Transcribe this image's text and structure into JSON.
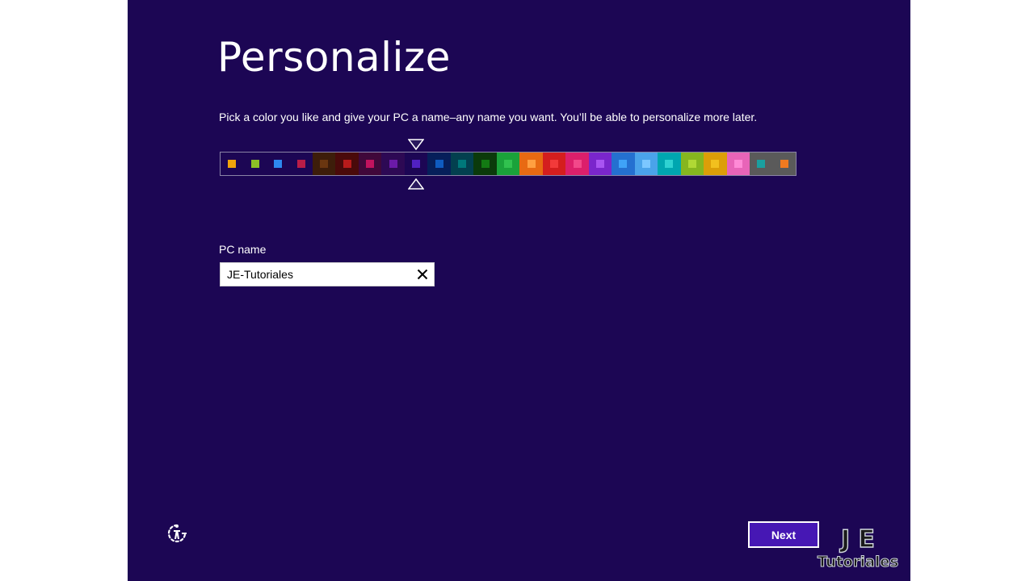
{
  "page": {
    "title": "Personalize",
    "subtitle": "Pick a color you like and give your PC a name–any name you want. You’ll be able to personalize more later.",
    "background": "#1c0654"
  },
  "color_picker": {
    "selected_index": 8,
    "cells": [
      {
        "bg": "#1c0654",
        "swatch": "#f0a30a"
      },
      {
        "bg": "#1c0654",
        "swatch": "#8cbf26"
      },
      {
        "bg": "#1c0654",
        "swatch": "#2d89ef"
      },
      {
        "bg": "#1c0654",
        "swatch": "#b91d47"
      },
      {
        "bg": "#3d1d0a",
        "swatch": "#6a3610"
      },
      {
        "bg": "#4a0a0a",
        "swatch": "#b81b1b"
      },
      {
        "bg": "#40083a",
        "swatch": "#c1135e"
      },
      {
        "bg": "#2d0954",
        "swatch": "#6b1aa8"
      },
      {
        "bg": "#1c0654",
        "swatch": "#5121c2"
      },
      {
        "bg": "#061f5a",
        "swatch": "#0f5cc0"
      },
      {
        "bg": "#03404f",
        "swatch": "#00787a"
      },
      {
        "bg": "#0b3a0b",
        "swatch": "#137a13"
      },
      {
        "bg": "#1aa23a",
        "swatch": "#31c24f"
      },
      {
        "bg": "#e86a12",
        "swatch": "#ffa041"
      },
      {
        "bg": "#d41e1e",
        "swatch": "#f23a3a"
      },
      {
        "bg": "#dc1f6b",
        "swatch": "#f2488a"
      },
      {
        "bg": "#7a26cc",
        "swatch": "#a954f2"
      },
      {
        "bg": "#2470d0",
        "swatch": "#3fa3f7"
      },
      {
        "bg": "#4aa3ea",
        "swatch": "#7cc7ff"
      },
      {
        "bg": "#00a6b0",
        "swatch": "#2fd2d2"
      },
      {
        "bg": "#86b61f",
        "swatch": "#b0d835"
      },
      {
        "bg": "#dc9e08",
        "swatch": "#f2c01e"
      },
      {
        "bg": "#e864b8",
        "swatch": "#ff8ad6"
      },
      {
        "bg": "#5a5a5a",
        "swatch": "#1a9f9f"
      },
      {
        "bg": "#5a5a5a",
        "swatch": "#f07a20"
      }
    ]
  },
  "pc_name": {
    "label": "PC name",
    "value": "JE-Tutoriales",
    "clear_icon": "close-icon"
  },
  "footer": {
    "next_label": "Next",
    "accessibility_icon": "ease-of-access-icon",
    "next_color": "#4617b4"
  },
  "watermark": {
    "line1": "J E",
    "line2": "Tutoriales"
  }
}
